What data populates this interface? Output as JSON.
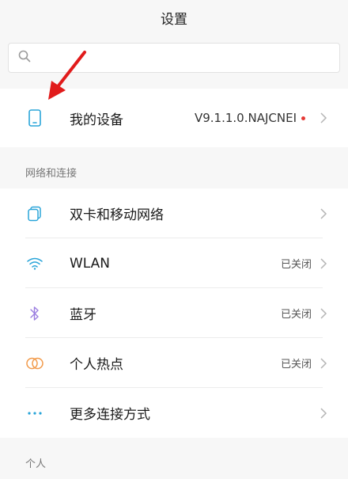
{
  "header": {
    "title": "设置"
  },
  "search": {
    "placeholder": "",
    "value": ""
  },
  "device": {
    "label": "我的设备",
    "version": "V9.1.1.0.NAJCNEI",
    "has_update_dot": true
  },
  "section_network": {
    "title": "网络和连接",
    "items": [
      {
        "label": "双卡和移动网络",
        "value": "",
        "icon": "sim-card-icon"
      },
      {
        "label": "WLAN",
        "value": "已关闭",
        "icon": "wifi-icon"
      },
      {
        "label": "蓝牙",
        "value": "已关闭",
        "icon": "bluetooth-icon"
      },
      {
        "label": "个人热点",
        "value": "已关闭",
        "icon": "hotspot-icon"
      },
      {
        "label": "更多连接方式",
        "value": "",
        "icon": "more-dots-icon"
      }
    ]
  },
  "section_personal": {
    "title": "个人"
  },
  "colors": {
    "accent_blue": "#2aa5d9",
    "bluetooth_purple": "#9b7ee0",
    "hotspot_orange": "#f29a4a",
    "annotation_red": "#e11b1b"
  }
}
